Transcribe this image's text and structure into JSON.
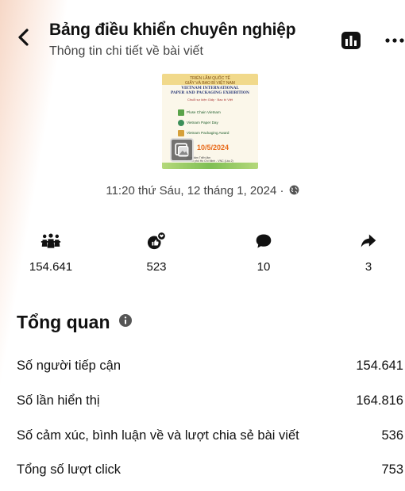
{
  "header": {
    "title": "Bảng điều khiển chuyên nghiệp",
    "subtitle": "Thông tin chi tiết về bài viết",
    "back_icon": "chevron-left-icon",
    "stats_icon": "bar-chart-icon",
    "more_icon": "more-horizontal-icon"
  },
  "post": {
    "thumbnail": {
      "header_text": "TRIỂN LÃM QUỐC TẾ\nGIẤY VÀ BAO BÌ VIỆT NAM",
      "title_text": "VIETNAM INTERNATIONAL\nPAPER AND PACKAGING EXHIBITION",
      "subtitle_text": "Chuỗi sự kiện Giấy · Bao bì Việt",
      "rows": [
        "Pluse Chain Vietnam",
        "Vietnam Paper Day",
        "Vietnam Packaging Award"
      ],
      "date_text": "10/5/2024",
      "footer_text": "Trung tâm Triển lãm\nThành phố Hồ Chí Minh - VNC (Lầu 2)"
    },
    "timestamp": "11:20 thứ Sáu, 12 tháng 1, 2024 ·",
    "privacy_icon": "globe-icon"
  },
  "metrics": [
    {
      "icon": "people-reach-icon",
      "value": "154.641"
    },
    {
      "icon": "reaction-icon",
      "value": "523"
    },
    {
      "icon": "comment-icon",
      "value": "10"
    },
    {
      "icon": "share-icon",
      "value": "3"
    }
  ],
  "overview": {
    "title": "Tổng quan",
    "info_icon": "info-icon",
    "rows": [
      {
        "label": "Số người tiếp cận",
        "value": "154.641"
      },
      {
        "label": "Số lần hiển thị",
        "value": "164.816"
      },
      {
        "label": "Số cảm xúc, bình luận về và lượt chia sẻ bài viết",
        "value": "536"
      },
      {
        "label": "Tổng số lượt click",
        "value": "753"
      }
    ]
  },
  "colors": {
    "text": "#111111",
    "muted": "#444444",
    "accent_orange": "#e86a1a"
  }
}
